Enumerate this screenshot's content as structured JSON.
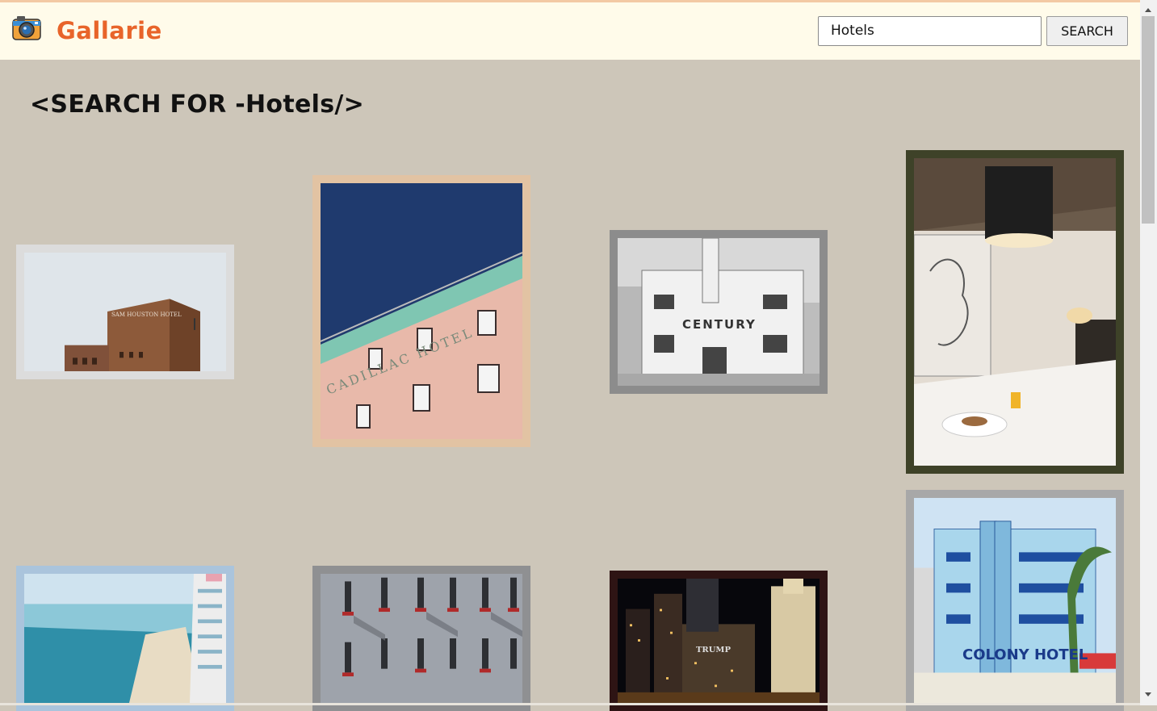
{
  "app": {
    "brand": "Gallarie"
  },
  "search": {
    "value": "Hotels",
    "button_label": "SEARCH"
  },
  "heading": "<SEARCH FOR -Hotels/>",
  "gallery": {
    "images": [
      {
        "sign_text": "SAM HOUSTON HOTEL",
        "frame_color": "#dcdcdc"
      },
      {
        "sign_text": "CADILLAC HOTEL",
        "frame_color": "#e2c3a3"
      },
      {
        "sign_text": "CENTURY",
        "frame_color": "#8c8c8c"
      },
      {
        "sign_text": "",
        "frame_color": "#3e4228"
      },
      {
        "sign_text": "",
        "frame_color": "#aac4dc"
      },
      {
        "sign_text": "",
        "frame_color": "#8f9092"
      },
      {
        "sign_text": "TRUMP",
        "frame_color": "#2e1414"
      },
      {
        "sign_text": "COLONY HOTEL",
        "frame_color": "#a8a8a8"
      }
    ]
  },
  "icons": {
    "logo": "camera-icon",
    "scroll_up": "chevron-up-icon",
    "scroll_down": "chevron-down-icon"
  }
}
